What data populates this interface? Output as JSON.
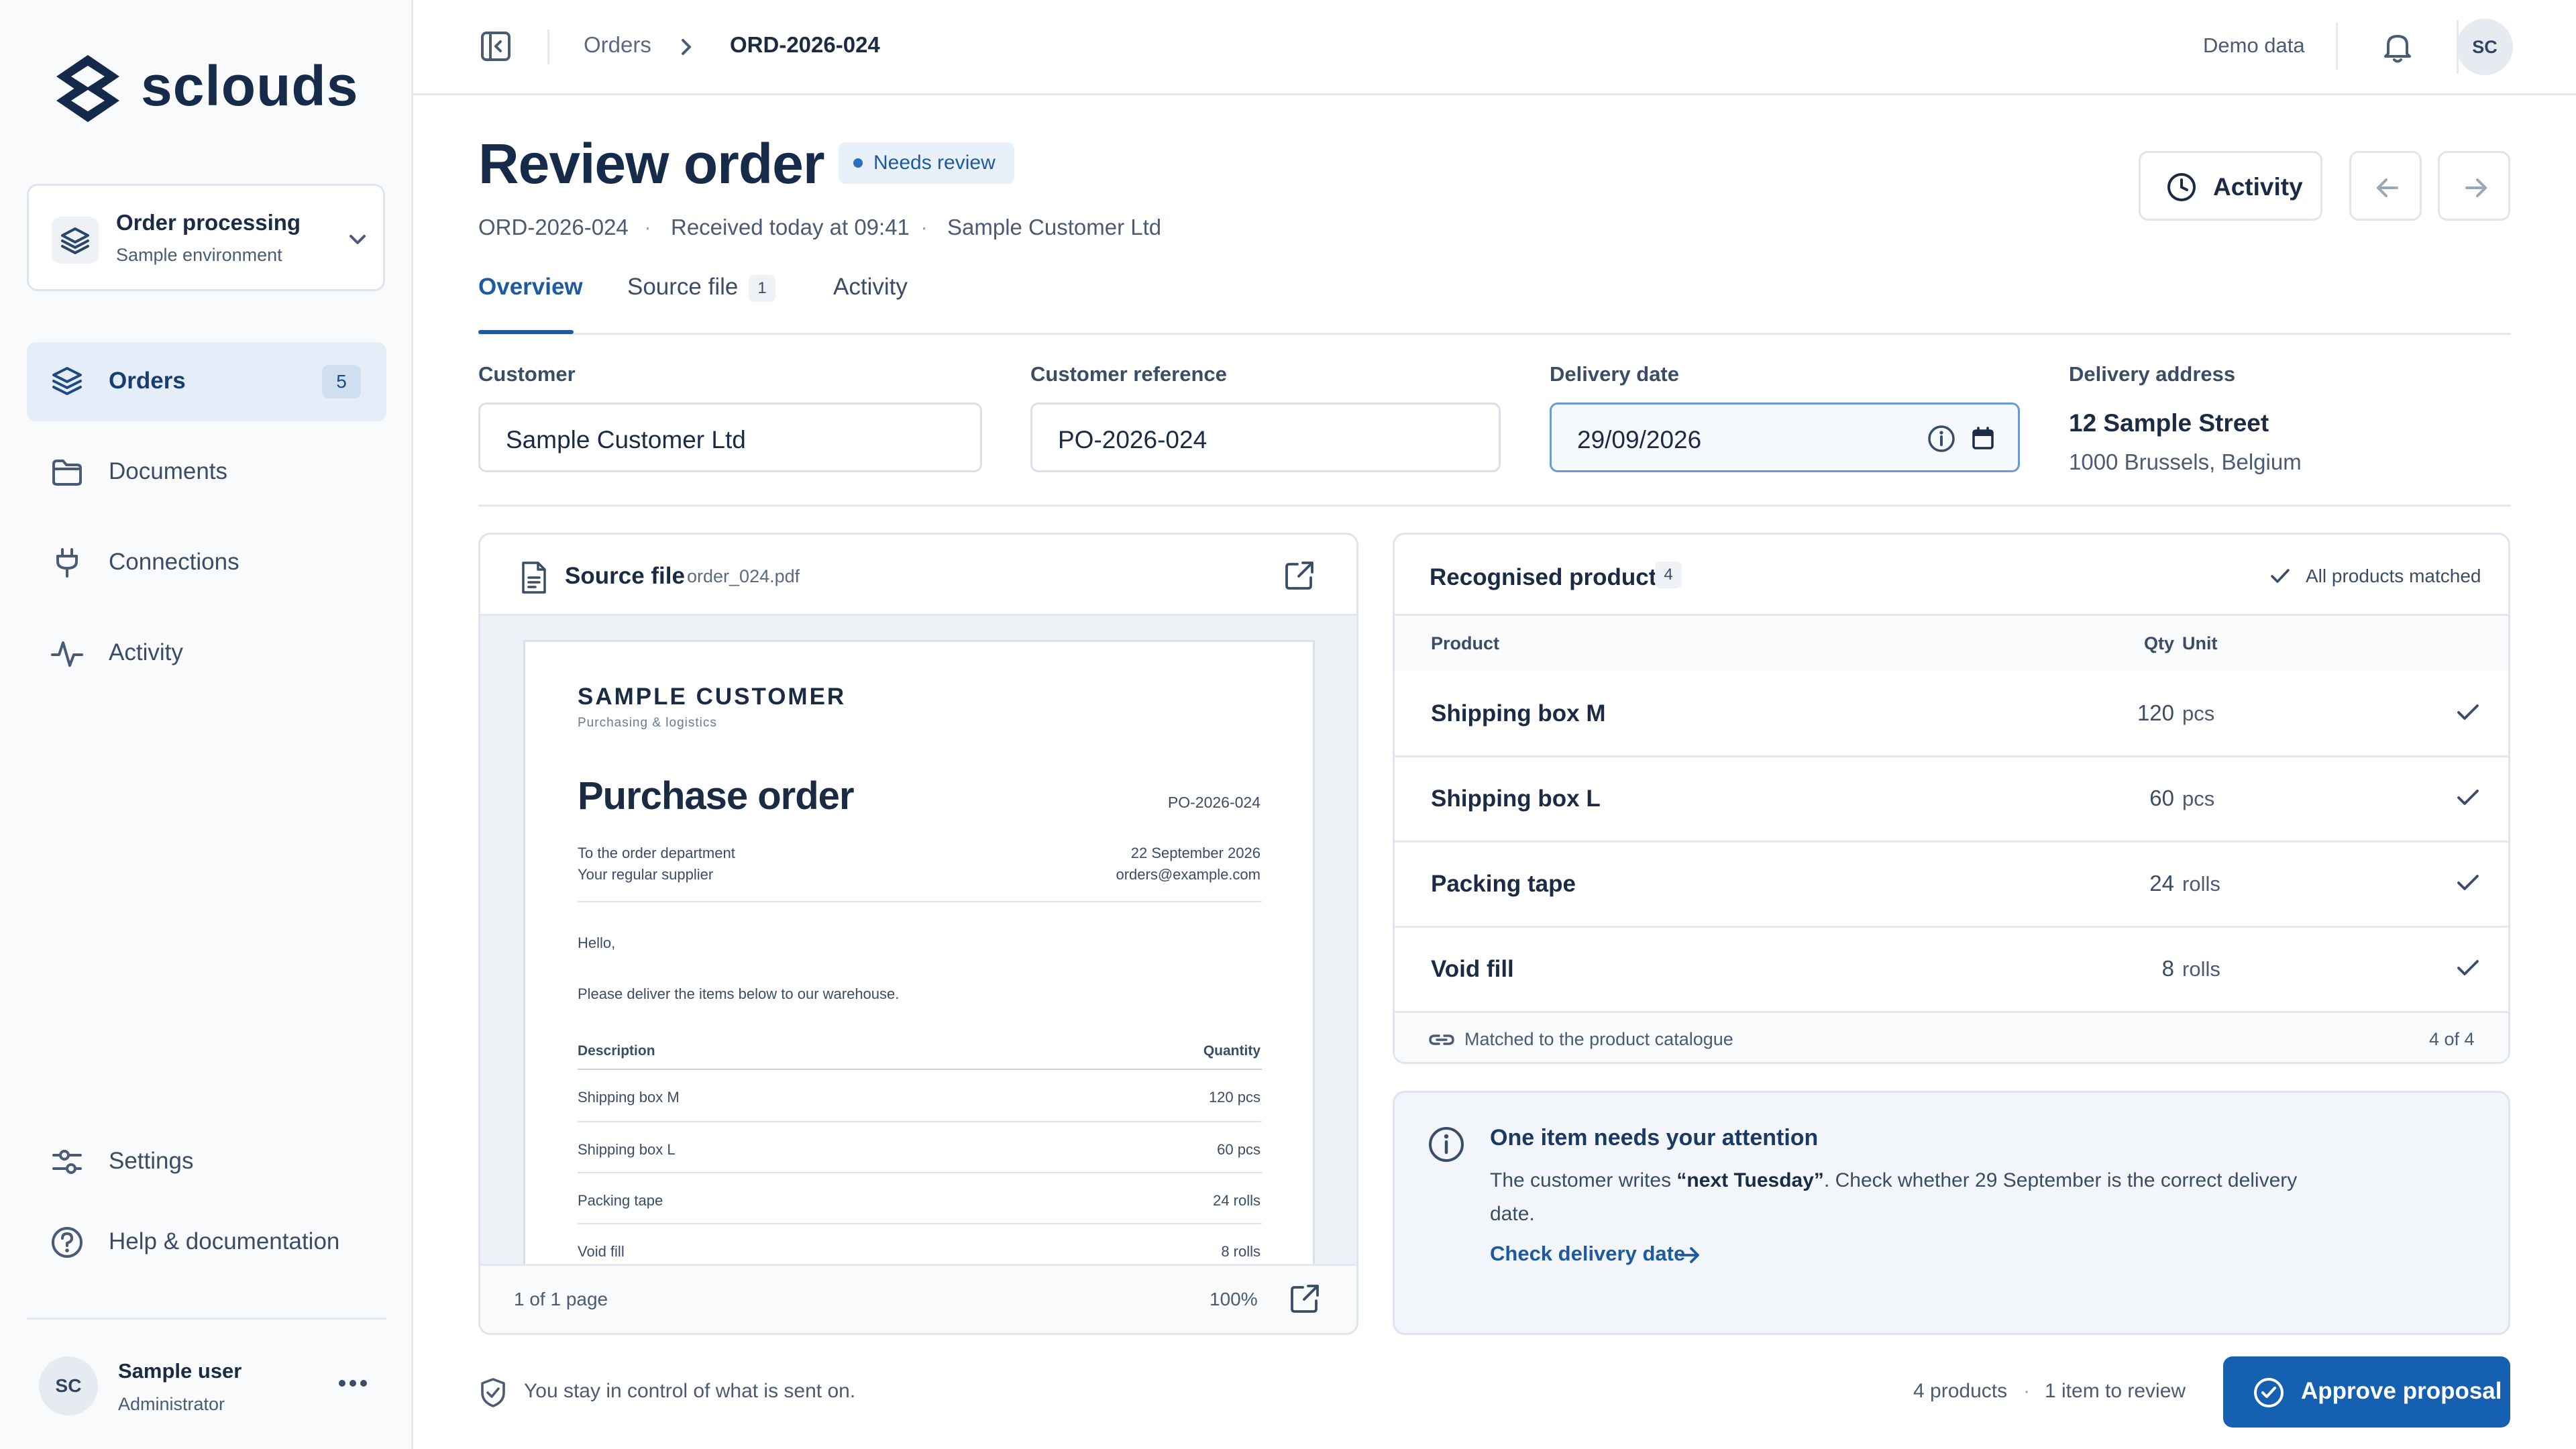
{
  "brand": {
    "name": "sclouds"
  },
  "workspace": {
    "title": "Order processing",
    "subtitle": "Sample environment"
  },
  "sidebar": {
    "items": [
      {
        "label": "Orders",
        "badge": "5"
      },
      {
        "label": "Documents"
      },
      {
        "label": "Connections"
      },
      {
        "label": "Activity"
      }
    ],
    "footer_items": [
      {
        "label": "Settings"
      },
      {
        "label": "Help & documentation"
      }
    ],
    "user": {
      "initials": "SC",
      "name": "Sample user",
      "role": "Administrator"
    }
  },
  "topbar": {
    "breadcrumb": {
      "parent": "Orders",
      "current": "ORD-2026-024"
    },
    "demo_label": "Demo data",
    "avatar_initials": "SC"
  },
  "header": {
    "title": "Review order",
    "status": "Needs review",
    "meta": {
      "order_id": "ORD-2026-024",
      "received": "Received today at 09:41",
      "customer": "Sample Customer Ltd",
      "separator": "·"
    },
    "activity_button": "Activity"
  },
  "tabs": [
    {
      "label": "Overview"
    },
    {
      "label": "Source file",
      "count": "1"
    },
    {
      "label": "Activity"
    }
  ],
  "fields": {
    "customer": {
      "label": "Customer",
      "value": "Sample Customer Ltd"
    },
    "reference": {
      "label": "Customer reference",
      "value": "PO-2026-024"
    },
    "delivery_date": {
      "label": "Delivery date",
      "value": "29/09/2026"
    },
    "address": {
      "label": "Delivery address",
      "line1": "12 Sample Street",
      "line2": "1000 Brussels, Belgium"
    }
  },
  "source_panel": {
    "title": "Source file",
    "filename": "order_024.pdf",
    "page_info": "1 of 1 page",
    "zoom": "100%",
    "document": {
      "company": "SAMPLE CUSTOMER",
      "tagline": "Purchasing & logistics",
      "heading": "Purchase order",
      "po_number": "PO-2026-024",
      "to_line1": "To the order department",
      "to_line2": "Your regular supplier",
      "date": "22 September 2026",
      "email": "orders@example.com",
      "greeting": "Hello,",
      "body": "Please deliver the items below to our warehouse.",
      "col_description": "Description",
      "col_quantity": "Quantity",
      "lines": [
        {
          "description": "Shipping box M",
          "quantity": "120 pcs"
        },
        {
          "description": "Shipping box L",
          "quantity": "60 pcs"
        },
        {
          "description": "Packing tape",
          "quantity": "24 rolls"
        },
        {
          "description": "Void fill",
          "quantity": "8 rolls"
        }
      ]
    }
  },
  "products_panel": {
    "title": "Recognised products",
    "count": "4",
    "status": "All products matched",
    "columns": {
      "product": "Product",
      "qty": "Qty",
      "unit": "Unit"
    },
    "rows": [
      {
        "product": "Shipping box M",
        "qty": "120",
        "unit": "pcs"
      },
      {
        "product": "Shipping box L",
        "qty": "60",
        "unit": "pcs"
      },
      {
        "product": "Packing tape",
        "qty": "24",
        "unit": "rolls"
      },
      {
        "product": "Void fill",
        "qty": "8",
        "unit": "rolls"
      }
    ],
    "footer_note": "Matched to the product catalogue",
    "footer_count": "4 of 4"
  },
  "notice": {
    "title": "One item needs your attention",
    "text_before": "The customer writes ",
    "quote": "“next Tuesday”",
    "text_after": ". Check whether 29 September is the correct delivery date.",
    "link": "Check delivery date"
  },
  "footer": {
    "control_note": "You stay in control of what is sent on.",
    "summary_products": "4 products",
    "summary_sep": "·",
    "summary_review": "1 item to review",
    "approve_label": "Approve proposal"
  }
}
